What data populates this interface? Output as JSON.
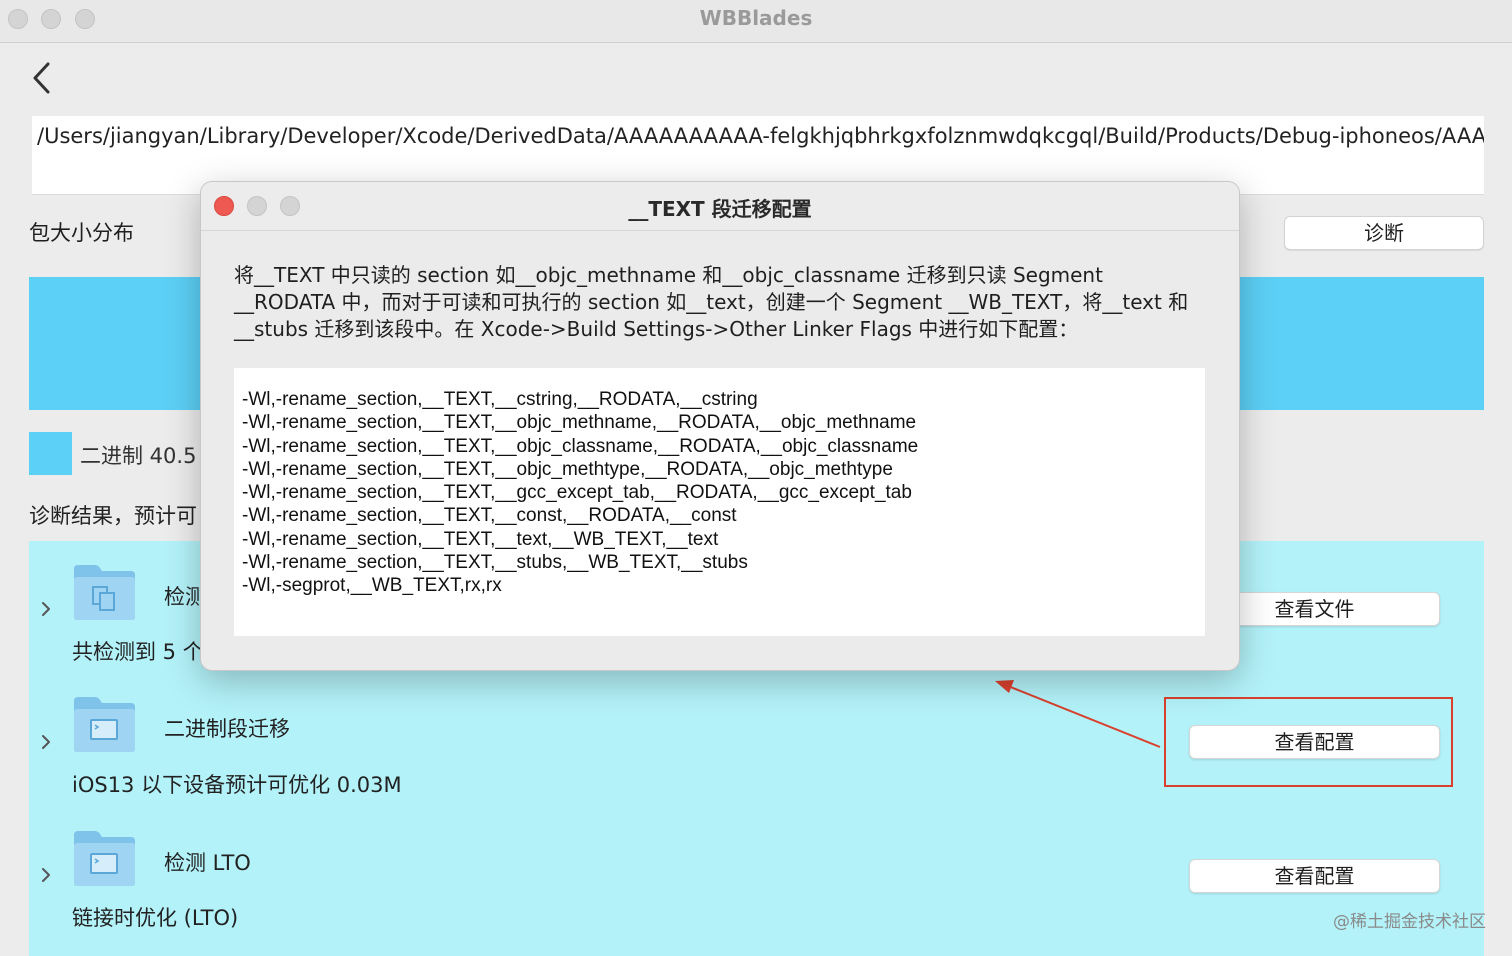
{
  "window": {
    "title": "WBBlades"
  },
  "path_field": {
    "value": "/Users/jiangyan/Library/Developer/Xcode/DerivedData/AAAAAAAAAA-felgkhjqbhrkgxfolznmwdqkcgql/Build/Products/Debug-iphoneos/AAAAAAA"
  },
  "size_section": {
    "label": "包大小分布",
    "diagnose_button": "诊断",
    "legend_text": "二进制 40.5",
    "bar_color": "#5cd0f6"
  },
  "diagnosis_summary": "诊断结果，预计可",
  "results": [
    {
      "title": "检测",
      "desc": "共检测到 5 个",
      "button": "查看文件",
      "icon": "folder-doc-icon"
    },
    {
      "title": "二进制段迁移",
      "desc": "iOS13 以下设备预计可优化 0.03M",
      "button": "查看配置",
      "icon": "folder-terminal-icon"
    },
    {
      "title": "检测 LTO",
      "desc": "链接时优化 (LTO)",
      "button": "查看配置",
      "icon": "folder-terminal-icon"
    }
  ],
  "modal": {
    "title": "__TEXT 段迁移配置",
    "description": "将__TEXT 中只读的 section 如__objc_methname 和__objc_classname 迁移到只读 Segment __RODATA 中，而对于可读和可执行的 section 如__text，创建一个 Segment __WB_TEXT，将__text 和__stubs 迁移到该段中。在 Xcode->Build Settings->Other Linker Flags 中进行如下配置：",
    "flags": [
      "-Wl,-rename_section,__TEXT,__cstring,__RODATA,__cstring",
      "-Wl,-rename_section,__TEXT,__objc_methname,__RODATA,__objc_methname",
      "-Wl,-rename_section,__TEXT,__objc_classname,__RODATA,__objc_classname",
      "-Wl,-rename_section,__TEXT,__objc_methtype,__RODATA,__objc_methtype",
      "-Wl,-rename_section,__TEXT,__gcc_except_tab,__RODATA,__gcc_except_tab",
      "-Wl,-rename_section,__TEXT,__const,__RODATA,__const",
      "-Wl,-rename_section,__TEXT,__text,__WB_TEXT,__text",
      "-Wl,-rename_section,__TEXT,__stubs,__WB_TEXT,__stubs",
      "-Wl,-segprot,__WB_TEXT,rx,rx"
    ]
  },
  "watermark": "@稀土掘金技术社区",
  "colors": {
    "results_bg": "#b3f2f9",
    "highlight": "#d9412e",
    "close_red": "#ee5a52"
  }
}
